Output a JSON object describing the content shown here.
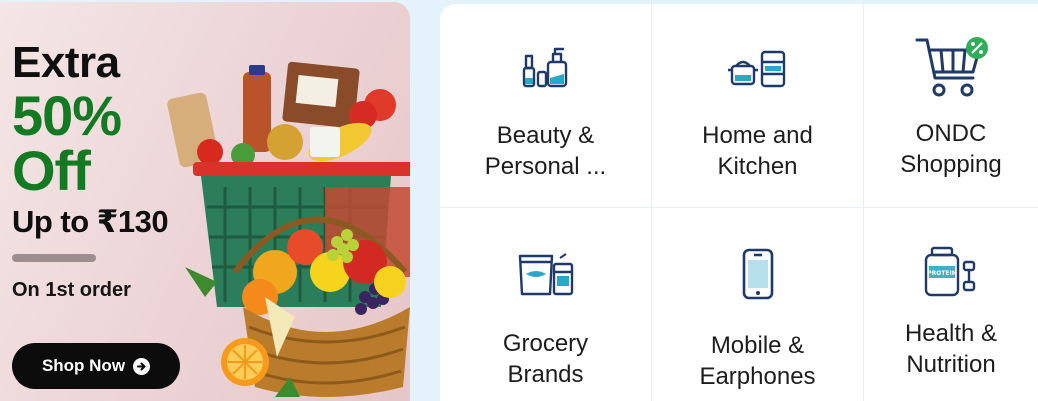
{
  "promo": {
    "line1": "Extra",
    "line2": "50%",
    "line3": "Off",
    "line4": "Up to ₹130",
    "line5": "On 1st order",
    "button_label": "Shop Now"
  },
  "categories": [
    {
      "label": "Beauty &\nPersonal ...",
      "icon": "beauty-bottles-icon"
    },
    {
      "label": "Home and\nKitchen",
      "icon": "cookware-icon"
    },
    {
      "label": "ONDC\nShopping",
      "icon": "shopping-cart-discount-icon"
    },
    {
      "label": "Grocery\nBrands",
      "icon": "grocery-packets-icon"
    },
    {
      "label": "Mobile &\nEarphones",
      "icon": "mobile-phone-icon"
    },
    {
      "label": "Health &\nNutrition",
      "icon": "protein-dumbbell-icon"
    }
  ],
  "colors": {
    "icon_navy": "#1f3a68",
    "accent_teal": "#2aa6c8",
    "discount_green": "#2fae5a",
    "promo_green": "#137a23"
  },
  "art": {
    "protein_label": "PROTEIN"
  }
}
